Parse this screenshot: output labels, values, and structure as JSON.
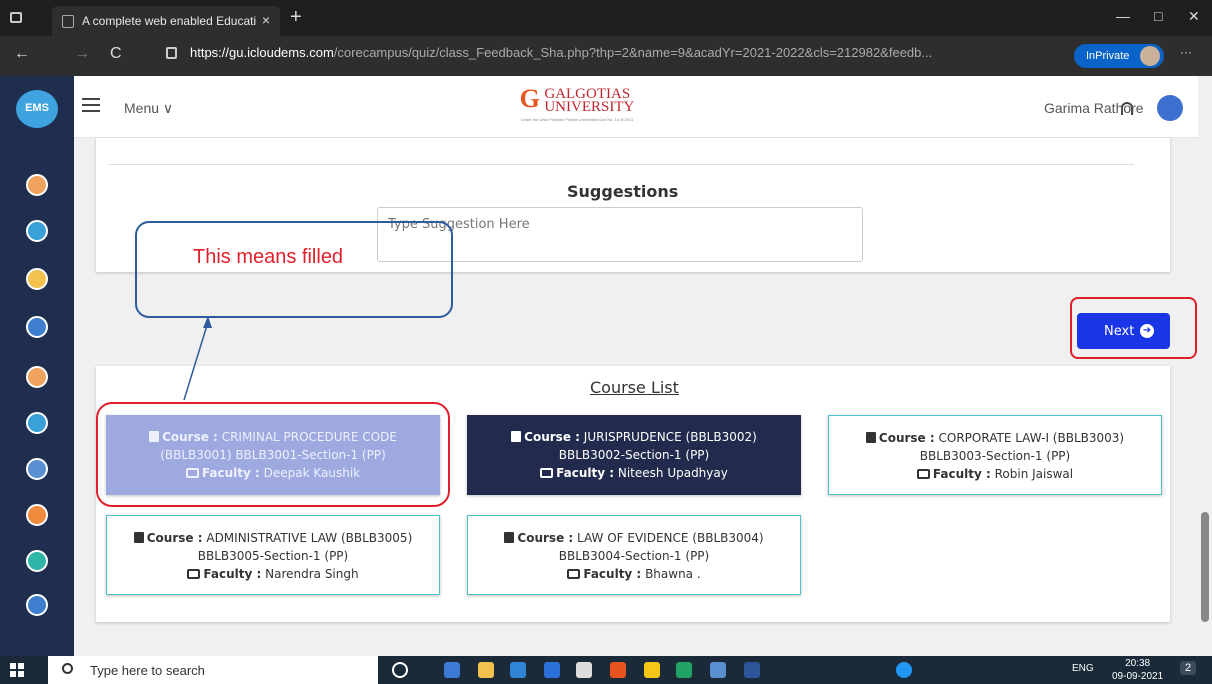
{
  "browser": {
    "tab_title": "A complete web enabled Educati",
    "tab_close": "×",
    "new_tab": "+",
    "url_host": "https://gu.icloudems.com",
    "url_path": "/corecampus/quiz/class_Feedback_Sha.php?thp=2&name=9&acadYr=2021-2022&cls=212982&feedb...",
    "inprivate": "InPrivate",
    "back": "←",
    "forward": "→",
    "reload": "C",
    "more": "···",
    "minimize": "—",
    "maximize": "□",
    "close": "✕"
  },
  "header": {
    "menu_label": "Menu ∨",
    "logo_letter": "G",
    "logo_line1": "GALGOTIAS",
    "logo_line2": "UNIVERSITY",
    "logo_small": "Under the Uttar Pradesh Private Universities Act No. 14 of 2011",
    "user_name": "Garima Rathore",
    "ems_logo": "EMS"
  },
  "suggestions": {
    "title": "Suggestions",
    "placeholder": "Type Suggestion Here"
  },
  "next_button": {
    "label": "Next",
    "arrow": "➜"
  },
  "course_list": {
    "title": "Course List",
    "course_label": "Course :",
    "faculty_label": "Faculty :",
    "courses": [
      {
        "name": "CRIMINAL PROCEDURE CODE",
        "code_line": "(BBLB3001) BBLB3001-Section-1 (PP)",
        "faculty": "Deepak Kaushik",
        "state": "filled"
      },
      {
        "name": "JURISPRUDENCE (BBLB3002)",
        "code_line": "BBLB3002-Section-1 (PP)",
        "faculty": "Niteesh Upadhyay",
        "state": "active"
      },
      {
        "name": "CORPORATE LAW-I (BBLB3003)",
        "code_line": "BBLB3003-Section-1 (PP)",
        "faculty": "Robin Jaiswal",
        "state": "pending"
      },
      {
        "name": "ADMINISTRATIVE LAW (BBLB3005)",
        "code_line": "BBLB3005-Section-1 (PP)",
        "faculty": "Narendra Singh",
        "state": "pending"
      },
      {
        "name": "LAW OF EVIDENCE (BBLB3004)",
        "code_line": "BBLB3004-Section-1 (PP)",
        "faculty": "Bhawna .",
        "state": "pending"
      }
    ]
  },
  "annotation": {
    "text": "This means filled",
    "color": "#e01f2a"
  },
  "taskbar": {
    "search_placeholder": "Type here to search",
    "time": "20:38",
    "date": "09-09-2021",
    "lang": "ENG",
    "notifications": "2"
  },
  "colors": {
    "filled_course": "#9ea9e0",
    "active_course": "#222a4d",
    "next_button": "#1a35e6",
    "highlight": "#e01f2a"
  }
}
